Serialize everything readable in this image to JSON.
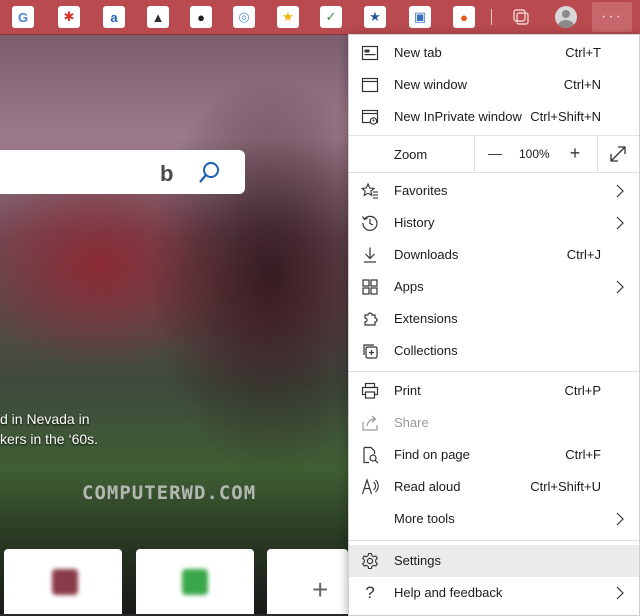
{
  "toolbar": {
    "extensions": [
      {
        "icon": "google-translate-icon",
        "glyph": "G",
        "color": "#4a7fd6"
      },
      {
        "icon": "pin-icon",
        "glyph": "✱",
        "color": "#d8322e"
      },
      {
        "icon": "at-sign-icon",
        "glyph": "a",
        "color": "#1f5fc9"
      },
      {
        "icon": "image-icon",
        "glyph": "▲",
        "color": "#2e2e2e"
      },
      {
        "icon": "ninja-icon",
        "glyph": "●",
        "color": "#222222"
      },
      {
        "icon": "swirl-icon",
        "glyph": "◎",
        "color": "#5a8ed6"
      },
      {
        "icon": "star-icon",
        "glyph": "★",
        "color": "#f2b600"
      },
      {
        "icon": "inbox-check-icon",
        "glyph": "✓",
        "color": "#3b8f3b"
      },
      {
        "icon": "bookmark-star-icon",
        "glyph": "★",
        "color": "#2a5aa0"
      },
      {
        "icon": "screenshot-icon",
        "glyph": "▣",
        "color": "#3a6fc2"
      },
      {
        "icon": "sunset-icon",
        "glyph": "●",
        "color": "#e8561e"
      }
    ],
    "collections_icon": "collections-icon",
    "profile_icon": "profile-icon",
    "more_label": "···"
  },
  "page": {
    "caption_lines": [
      "d in Nevada in",
      "kers in the ‘60s."
    ],
    "watermark": "COMPUTERWD.COM",
    "add_tile": "+"
  },
  "menu": {
    "new_tab": {
      "label": "New tab",
      "shortcut": "Ctrl+T"
    },
    "new_window": {
      "label": "New window",
      "shortcut": "Ctrl+N"
    },
    "new_inprivate": {
      "label": "New InPrivate window",
      "shortcut": "Ctrl+Shift+N"
    },
    "zoom": {
      "label": "Zoom",
      "minus": "—",
      "value": "100%",
      "plus": "+"
    },
    "favorites": {
      "label": "Favorites"
    },
    "history": {
      "label": "History"
    },
    "downloads": {
      "label": "Downloads",
      "shortcut": "Ctrl+J"
    },
    "apps": {
      "label": "Apps"
    },
    "extensions": {
      "label": "Extensions"
    },
    "collections": {
      "label": "Collections"
    },
    "print": {
      "label": "Print",
      "shortcut": "Ctrl+P"
    },
    "share": {
      "label": "Share"
    },
    "find": {
      "label": "Find on page",
      "shortcut": "Ctrl+F"
    },
    "read_aloud": {
      "label": "Read aloud",
      "shortcut": "Ctrl+Shift+U"
    },
    "more_tools": {
      "label": "More tools"
    },
    "settings": {
      "label": "Settings"
    },
    "help": {
      "label": "Help and feedback"
    }
  }
}
